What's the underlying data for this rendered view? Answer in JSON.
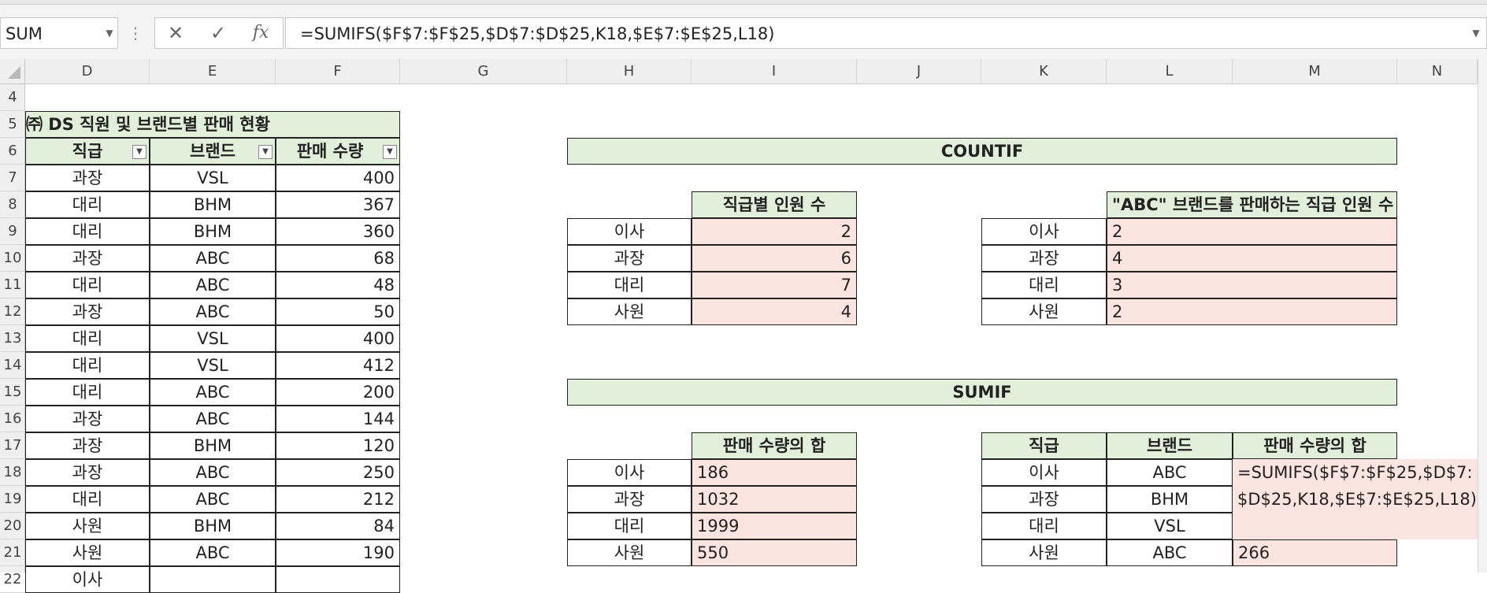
{
  "formula_bar": {
    "name_box": "SUM",
    "cancel_icon": "✕",
    "enter_icon": "✓",
    "fx_icon": "fx",
    "formula": "=SUMIFS($F$7:$F$25,$D$7:$D$25,K18,$E$7:$E$25,L18)"
  },
  "columns": [
    "D",
    "E",
    "F",
    "G",
    "H",
    "I",
    "J",
    "K",
    "L",
    "M",
    "N"
  ],
  "rows": [
    "4",
    "5",
    "6",
    "7",
    "8",
    "9",
    "10",
    "11",
    "12",
    "13",
    "14",
    "15",
    "16",
    "17",
    "18",
    "19",
    "20",
    "21",
    "22"
  ],
  "left_table": {
    "title": "㈜ DS 직원 및 브랜드별 판매 현황",
    "headers": [
      "직급",
      "브랜드",
      "판매 수량"
    ],
    "rows": [
      [
        "과장",
        "VSL",
        "400"
      ],
      [
        "대리",
        "BHM",
        "367"
      ],
      [
        "대리",
        "BHM",
        "360"
      ],
      [
        "과장",
        "ABC",
        "68"
      ],
      [
        "대리",
        "ABC",
        "48"
      ],
      [
        "과장",
        "ABC",
        "50"
      ],
      [
        "대리",
        "VSL",
        "400"
      ],
      [
        "대리",
        "VSL",
        "412"
      ],
      [
        "대리",
        "ABC",
        "200"
      ],
      [
        "과장",
        "ABC",
        "144"
      ],
      [
        "과장",
        "BHM",
        "120"
      ],
      [
        "과장",
        "ABC",
        "250"
      ],
      [
        "대리",
        "ABC",
        "212"
      ],
      [
        "사원",
        "BHM",
        "84"
      ],
      [
        "사원",
        "ABC",
        "190"
      ],
      [
        "이사",
        "",
        ""
      ]
    ]
  },
  "countif": {
    "title": "COUNTIF",
    "table1_header": "직급별 인원 수",
    "table1_rows": [
      [
        "이사",
        "2"
      ],
      [
        "과장",
        "6"
      ],
      [
        "대리",
        "7"
      ],
      [
        "사원",
        "4"
      ]
    ],
    "table2_header": "\"ABC\" 브랜드를 판매하는 직급 인원 수",
    "table2_rows": [
      [
        "이사",
        "2"
      ],
      [
        "과장",
        "4"
      ],
      [
        "대리",
        "3"
      ],
      [
        "사원",
        "2"
      ]
    ]
  },
  "sumif": {
    "title": "SUMIF",
    "table1_header": "판매 수량의 합",
    "table1_rows": [
      [
        "이사",
        "186"
      ],
      [
        "과장",
        "1032"
      ],
      [
        "대리",
        "1999"
      ],
      [
        "사원",
        "550"
      ]
    ],
    "table2_headers": [
      "직급",
      "브랜드",
      "판매 수량의 합"
    ],
    "table2_rows": [
      [
        "이사",
        "ABC",
        ""
      ],
      [
        "과장",
        "BHM",
        ""
      ],
      [
        "대리",
        "VSL",
        ""
      ],
      [
        "사원",
        "ABC",
        "266"
      ]
    ],
    "editing_formula_line1": "=SUMIFS($F$7:$F$25,$D$7:",
    "editing_formula_line2": "$D$25,K18,$E$7:$E$25,L18)"
  },
  "colors": {
    "header_fill": "#e2efda",
    "result_fill": "#fce4e0",
    "border": "#222222"
  }
}
